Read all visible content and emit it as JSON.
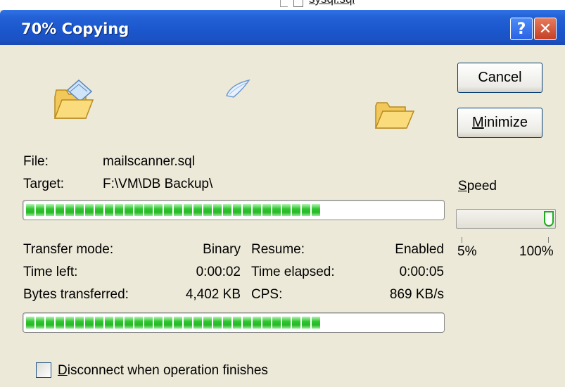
{
  "background": {
    "file_name": "sysql.sql"
  },
  "window": {
    "title": "70% Copying",
    "help_label": "?",
    "close_label": "✕"
  },
  "buttons": {
    "cancel": "Cancel",
    "minimize_mnemonic": "M",
    "minimize_rest": "inimize"
  },
  "file": {
    "label": "File:",
    "value": "mailscanner.sql"
  },
  "target": {
    "label": "Target:",
    "value": "F:\\VM\\DB Backup\\"
  },
  "progress": {
    "file_percent": 0.7,
    "total_percent": 0.7
  },
  "speed": {
    "label_mnemonic": "S",
    "label_rest": "peed",
    "min": "5%",
    "max": "100%",
    "level": 1.0
  },
  "stats": {
    "transfer_mode_label": "Transfer mode:",
    "transfer_mode": "Binary",
    "time_left_label": "Time left:",
    "time_left": "0:00:02",
    "bytes_label": "Bytes transferred:",
    "bytes": "4,402 KB",
    "resume_label": "Resume:",
    "resume": "Enabled",
    "elapsed_label": "Time elapsed:",
    "elapsed": "0:00:05",
    "cps_label": "CPS:",
    "cps": "869 KB/s"
  },
  "disconnect": {
    "mnemonic": "D",
    "rest": "isconnect when operation finishes",
    "checked": false
  },
  "icons": [
    "open-folder-source-icon",
    "flying-paper-icon",
    "open-folder-target-icon"
  ]
}
